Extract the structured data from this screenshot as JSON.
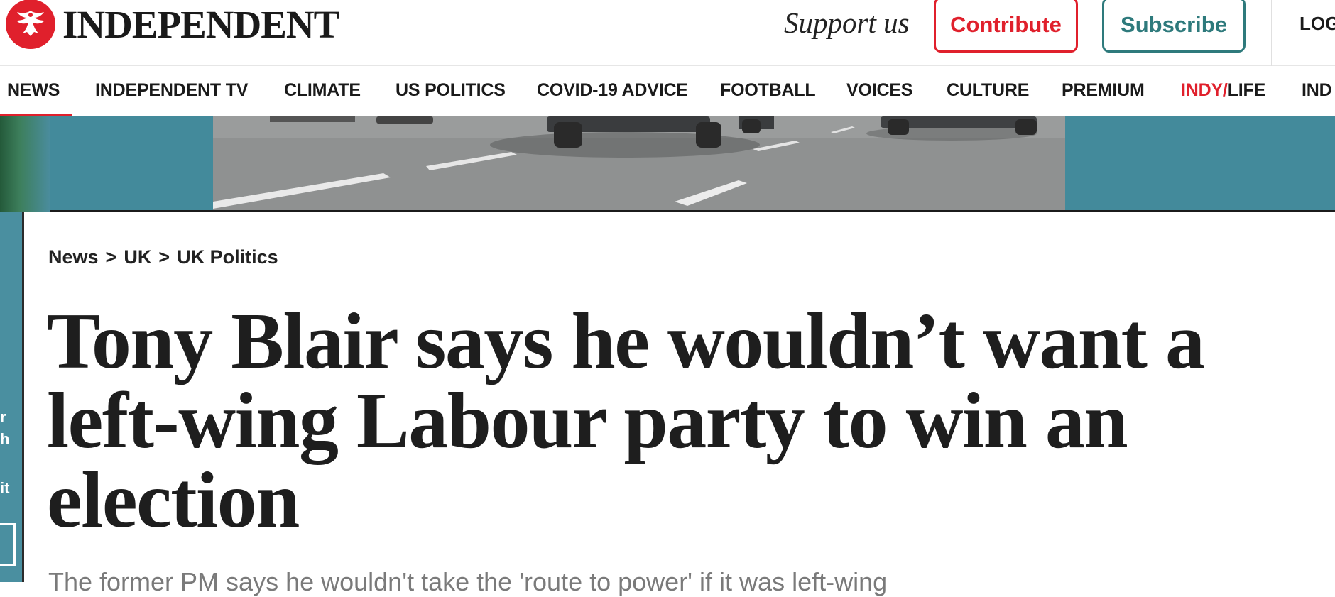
{
  "header": {
    "logo_text": "INDEPENDENT",
    "support_text": "Support us",
    "contribute_label": "Contribute",
    "subscribe_label": "Subscribe",
    "login_label": "LOG"
  },
  "nav": {
    "items": [
      {
        "label": "NEWS",
        "active": true
      },
      {
        "label": "INDEPENDENT TV"
      },
      {
        "label": "CLIMATE"
      },
      {
        "label": "US POLITICS"
      },
      {
        "label": "COVID-19 ADVICE"
      },
      {
        "label": "FOOTBALL"
      },
      {
        "label": "VOICES"
      },
      {
        "label": "CULTURE"
      },
      {
        "label": "PREMIUM"
      },
      {
        "label_red": "INDY/",
        "label_rest": "LIFE"
      },
      {
        "label": "IND"
      }
    ]
  },
  "left_strip": {
    "glyphs": [
      "r",
      "h",
      "it"
    ]
  },
  "article": {
    "breadcrumb": [
      {
        "label": "News"
      },
      {
        "label": "UK"
      },
      {
        "label": "UK Politics"
      }
    ],
    "breadcrumb_separator": ">",
    "headline": "Tony Blair says he wouldn’t want a left-wing Labour party to win an election",
    "standfirst": "The former PM says he wouldn't take the 'route to power' if it was left-wing"
  },
  "colors": {
    "brand_red": "#e0202c",
    "subscribe_teal": "#2e7a7c",
    "ad_teal": "#438a9b"
  }
}
